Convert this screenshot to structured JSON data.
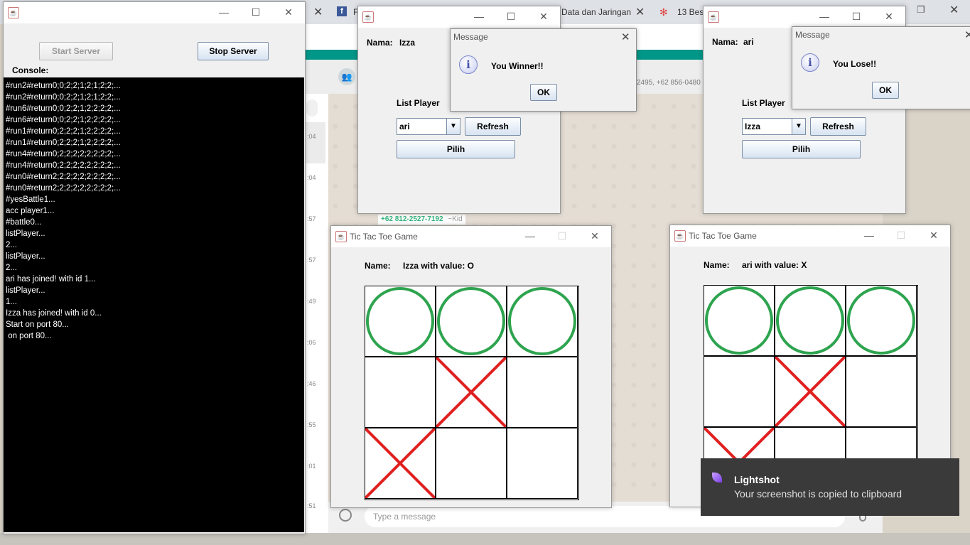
{
  "browser": {
    "tabs": [
      {
        "label": "F"
      },
      {
        "label": "Data dan Jaringan"
      },
      {
        "label": "13 Best"
      }
    ]
  },
  "whatsapp": {
    "header_numbers": "2495, +62 856-0480",
    "sender": "+62 812-2527-7192",
    "sender_name": "~Kid",
    "times": [
      ":04",
      ":04",
      ":57",
      ":57",
      ":49",
      ":06",
      ":46",
      ":55",
      ":01",
      ":51"
    ],
    "input_placeholder": "Type a message"
  },
  "server_window": {
    "start_label": "Start Server",
    "stop_label": "Stop Server",
    "console_label": "Console:",
    "console_lines": [
      "#run2#return0;0;2;2;1;2;1;2;2;...",
      "#run2#return0;0;2;2;1;2;1;2;2;...",
      "#run6#return0;0;2;2;1;2;2;2;2;...",
      "#run6#return0;0;2;2;1;2;2;2;2;...",
      "#run1#return0;2;2;2;1;2;2;2;2;...",
      "#run1#return0;2;2;2;1;2;2;2;2;...",
      "#run4#return0;2;2;2;2;2;2;2;2;...",
      "#run4#return0;2;2;2;2;2;2;2;2;...",
      "#run0#return2;2;2;2;2;2;2;2;2;...",
      "#run0#return2;2;2;2;2;2;2;2;2;...",
      "#yesBattle1...",
      "acc player1...",
      "#battle0...",
      "listPlayer...",
      "2...",
      "listPlayer...",
      "2...",
      "ari has joined! with id 1...",
      "listPlayer...",
      "1...",
      "Izza has joined! with id 0...",
      "Start on port 80...",
      " on port 80..."
    ]
  },
  "lobby_left": {
    "name_label": "Nama:",
    "name_value": "Izza",
    "list_label": "List Player",
    "combo_value": "ari",
    "refresh_label": "Refresh",
    "pick_label": "Pilih"
  },
  "lobby_right": {
    "name_label": "Nama:",
    "name_value": "ari",
    "list_label": "List Player",
    "combo_value": "Izza",
    "refresh_label": "Refresh",
    "pick_label": "Pilih"
  },
  "message_left": {
    "title": "Message",
    "text": "You Winner!!",
    "ok_label": "OK"
  },
  "message_right": {
    "title": "Message",
    "text": "You Lose!!",
    "ok_label": "OK"
  },
  "game_left": {
    "title": "Tic Tac Toe Game",
    "name_label": "Name:",
    "name_value": "Izza with value: O",
    "board": [
      "O",
      "O",
      "O",
      "",
      "X",
      "",
      "X",
      "",
      ""
    ]
  },
  "game_right": {
    "title": "Tic Tac Toe Game",
    "name_label": "Name:",
    "name_value": "ari with value: X",
    "board": [
      "O",
      "O",
      "O",
      "",
      "X",
      "",
      "X",
      "",
      ""
    ]
  },
  "toast": {
    "title": "Lightshot",
    "text": "Your screenshot is copied to clipboard"
  },
  "colors": {
    "o_mark": "#2ea44f",
    "x_mark": "#e02020",
    "wa_teal": "#009688"
  }
}
